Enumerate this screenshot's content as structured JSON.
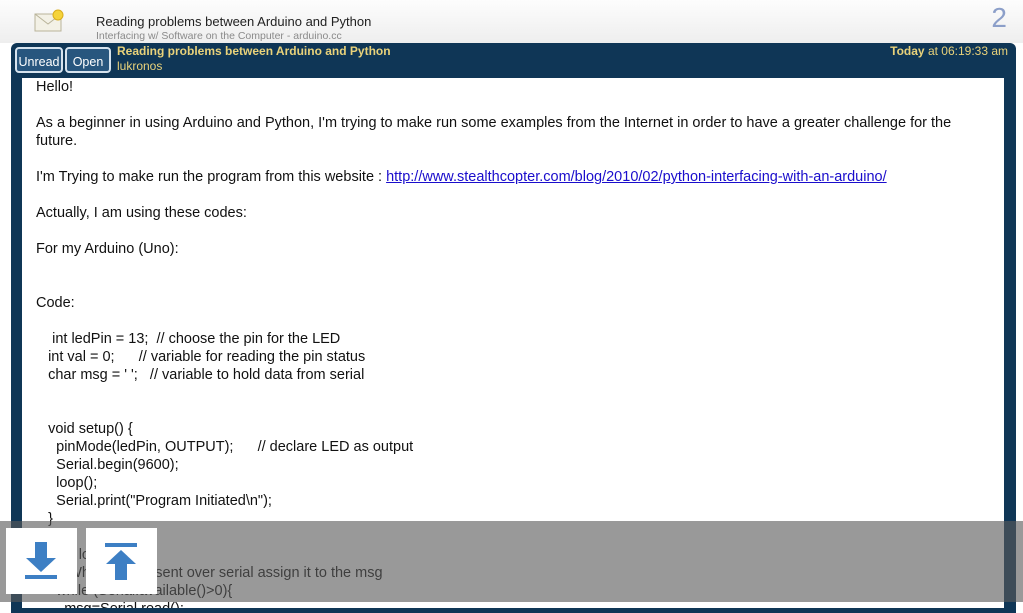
{
  "header": {
    "title": "Reading problems between Arduino and Python",
    "subtitle": "Interfacing w/ Software on the Computer - arduino.cc",
    "count": "2",
    "icon": "envelope-icon"
  },
  "message": {
    "buttons": {
      "unread": "Unread",
      "open": "Open"
    },
    "subject": "Reading problems between Arduino and Python",
    "author": "lukronos",
    "time_day": "Today",
    "time_rest": " at 06:19:33 am",
    "body": {
      "greeting": "Hello!",
      "para1": "As a beginner  in using  Arduino and Python, I'm trying to make run some examples from the Internet in order to have a greater challenge for the future.",
      "para2_prefix": "I'm Trying to make run the program from this website : ",
      "para2_link": "http://www.stealthcopter.com/blog/2010/02/python-interfacing-with-an-arduino/",
      "para3": "Actually, I am using these codes:",
      "para4": "For my Arduino (Uno):",
      "code_label": "Code:",
      "code_lines": [
        "    int ledPin = 13;  // choose the pin for the LED",
        "   int val = 0;      // variable for reading the pin status",
        "   char msg = ' ';   // variable to hold data from serial",
        "",
        "",
        "   void setup() {",
        "     pinMode(ledPin, OUTPUT);      // declare LED as output",
        "     Serial.begin(9600);",
        "     loop();",
        "     Serial.print(\"Program Initiated\\n\");",
        "   }",
        "",
        "   void loop () {",
        "     // While data is sent over serial assign it to the msg",
        "     while (Serial.available()>0){",
        "       msg=Serial.read();"
      ]
    }
  },
  "nav": {
    "down_icon": "arrow-down-to-bottom-icon",
    "up_icon": "arrow-up-to-top-icon"
  },
  "colors": {
    "panel": "#0f3656",
    "header_text": "#e9d27a",
    "link": "#1a0dcc",
    "arrow": "#3d7fc4"
  }
}
